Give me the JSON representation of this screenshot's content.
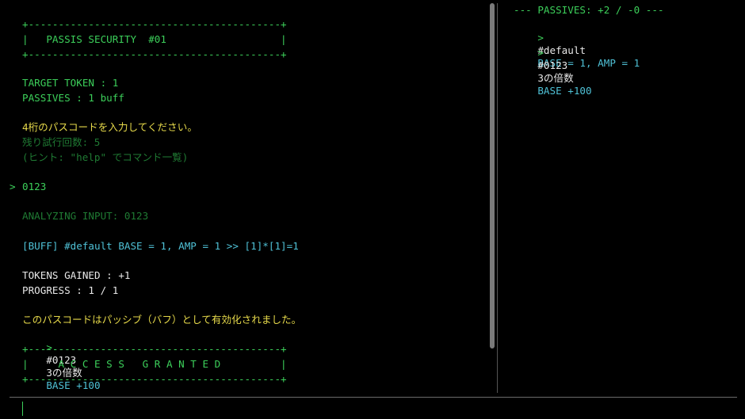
{
  "terminal": {
    "banner_top": "+------------------------------------------+",
    "banner_title": "|   PASSIS SECURITY  #01                   |",
    "banner_bottom": "+------------------------------------------+",
    "target_token": "TARGET TOKEN : 1",
    "passives": "PASSIVES : 1 buff",
    "prompt_msg": "4桁のパスコードを入力してください。",
    "remaining_tries": "残り試行回数: 5",
    "hint": "(ヒント: \"help\" でコマンド一覧)",
    "input_prompt_symbol": ">",
    "input_echo": "0123",
    "analyzing": "ANALYZING INPUT: 0123",
    "buff_line": "[BUFF] #default BASE = 1, AMP = 1 >> [1]*[1]=1",
    "tokens_gained": "TOKENS GAINED : +1",
    "progress": "PROGRESS : 1 / 1",
    "activated_msg": "このパスコードはパッシブ（バフ）として有効化されました。",
    "new_passive": {
      "arrow": ">",
      "id": "#0123",
      "desc": "3の倍数",
      "effect": "BASE +100"
    },
    "access_top": "+------------------------------------------+",
    "access_text": "|     A C C E S S   G R A N T E D          |",
    "access_bottom": "+------------------------------------------+"
  },
  "passives_panel": {
    "header": "--- PASSIVES: +2 / -0 ---",
    "items": [
      {
        "arrow": ">",
        "id": "#default",
        "effect": "BASE = 1, AMP = 1"
      },
      {
        "arrow": ">",
        "id": "#0123",
        "desc": "3の倍数",
        "effect": "BASE +100"
      }
    ]
  },
  "colors": {
    "background": "#000000",
    "green": "#3ccf5a",
    "dim_green": "#1f7a33",
    "cyan": "#4fc1d6",
    "yellow": "#e6d94a",
    "white": "#e8e8e8"
  }
}
